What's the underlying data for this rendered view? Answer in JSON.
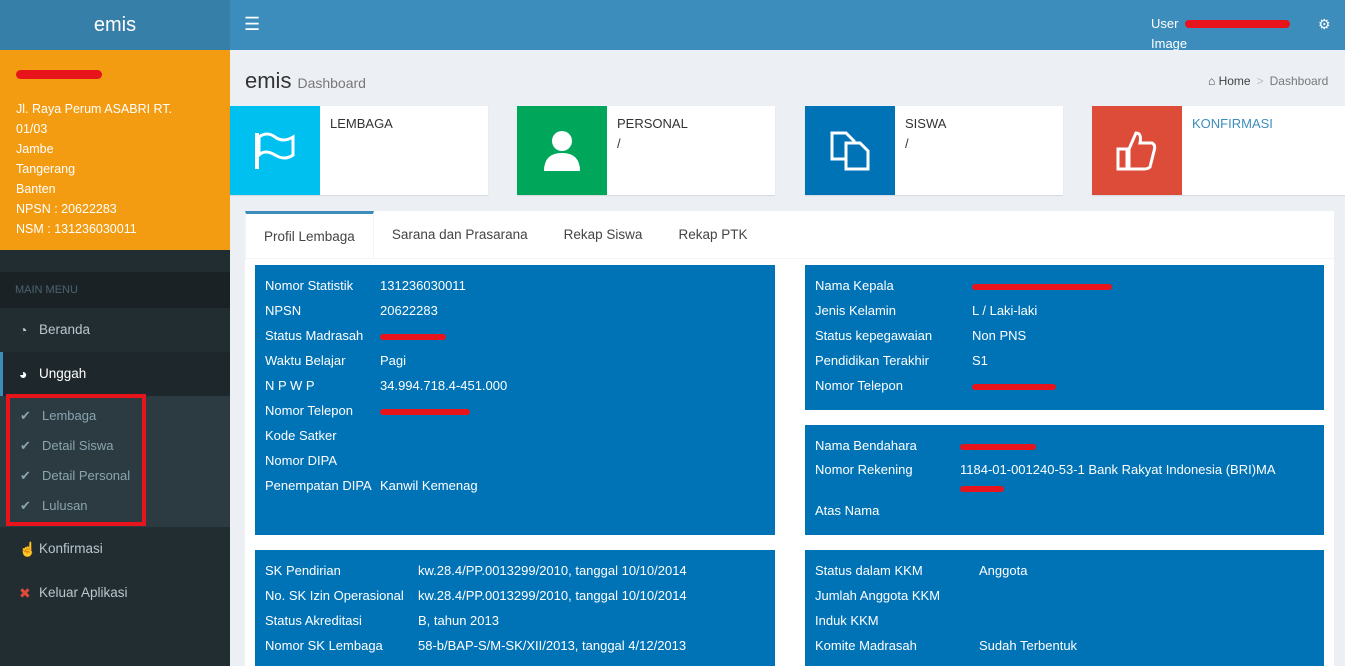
{
  "app": {
    "title": "emis"
  },
  "user_panel": {
    "address_lines": [
      "Jl. Raya Perum ASABRI RT.",
      "01/03",
      "Jambe",
      "Tangerang",
      "Banten"
    ],
    "npsn": "NPSN : 20622283",
    "nsm": "NSM : 131236030011"
  },
  "sidebar": {
    "header": "MAIN MENU",
    "items": [
      {
        "label": "Beranda",
        "icon": "dashboard-icon"
      },
      {
        "label": "Unggah",
        "icon": "globe-icon"
      },
      {
        "label": "Konfirmasi",
        "icon": "thumbs-up-icon"
      },
      {
        "label": "Keluar Aplikasi",
        "icon": "times-circle-icon"
      }
    ],
    "submenu": [
      {
        "label": "Lembaga"
      },
      {
        "label": "Detail Siswa"
      },
      {
        "label": "Detail Personal"
      },
      {
        "label": "Lulusan"
      }
    ]
  },
  "topbar": {
    "user_label": "User",
    "image_label": "Image"
  },
  "content": {
    "title": "emis",
    "subtitle": "Dashboard",
    "breadcrumb": {
      "home": "Home",
      "current": "Dashboard"
    }
  },
  "info_boxes": [
    {
      "label": "LEMBAGA",
      "value": "",
      "color": "#00c0ef",
      "icon": "flag-icon"
    },
    {
      "label": "PERSONAL",
      "value": "/",
      "color": "#00a65a",
      "icon": "user-icon"
    },
    {
      "label": "SISWA",
      "value": "/",
      "color": "#0073b7",
      "icon": "copy-icon"
    },
    {
      "label": "KONFIRMASI",
      "value": "",
      "color": "#dd4b39",
      "icon": "thumbs-up-icon"
    }
  ],
  "tabs": [
    "Profil Lembaga",
    "Sarana dan Prasarana",
    "Rekap Siswa",
    "Rekap PTK"
  ],
  "profil": {
    "rows": [
      {
        "k": "Nomor Statistik",
        "v": "131236030011"
      },
      {
        "k": "NPSN",
        "v": "20622283"
      },
      {
        "k": "Status Madrasah",
        "v": ""
      },
      {
        "k": "Waktu Belajar",
        "v": "Pagi"
      },
      {
        "k": "N P W P",
        "v": "34.994.718.4-451.000"
      },
      {
        "k": "Nomor Telepon",
        "v": ""
      },
      {
        "k": "Kode Satker",
        "v": ""
      },
      {
        "k": "Nomor DIPA",
        "v": ""
      },
      {
        "k": "Penempatan DIPA",
        "v": "Kanwil Kemenag"
      }
    ]
  },
  "kepala": {
    "rows": [
      {
        "k": "Nama Kepala",
        "v": ""
      },
      {
        "k": "Jenis Kelamin",
        "v": "L / Laki-laki"
      },
      {
        "k": "Status kepegawaian",
        "v": "Non PNS"
      },
      {
        "k": "Pendidikan Terakhir",
        "v": "S1"
      },
      {
        "k": "Nomor Telepon",
        "v": ""
      }
    ]
  },
  "bendahara": {
    "rows": [
      {
        "k": "Nama Bendahara",
        "v": ""
      },
      {
        "k": "Nomor Rekening",
        "v": "1184-01-001240-53-1 Bank Rakyat Indonesia (BRI)MA"
      },
      {
        "k": "Atas Nama",
        "v": ""
      }
    ]
  },
  "sk": {
    "rows": [
      {
        "k": "SK Pendirian",
        "v": "kw.28.4/PP.0013299/2010, tanggal 10/10/2014"
      },
      {
        "k": "No. SK Izin Operasional",
        "v": "kw.28.4/PP.0013299/2010, tanggal 10/10/2014"
      },
      {
        "k": "Status Akreditasi",
        "v": "B, tahun 2013"
      },
      {
        "k": "Nomor SK Lembaga",
        "v": "58-b/BAP-S/M-SK/XII/2013, tanggal 4/12/2013"
      }
    ]
  },
  "kkm": {
    "rows": [
      {
        "k": "Status dalam KKM",
        "v": "Anggota"
      },
      {
        "k": "Jumlah Anggota KKM",
        "v": ""
      },
      {
        "k": "Induk KKM",
        "v": ""
      },
      {
        "k": "Komite Madrasah",
        "v": "Sudah Terbentuk"
      }
    ]
  }
}
